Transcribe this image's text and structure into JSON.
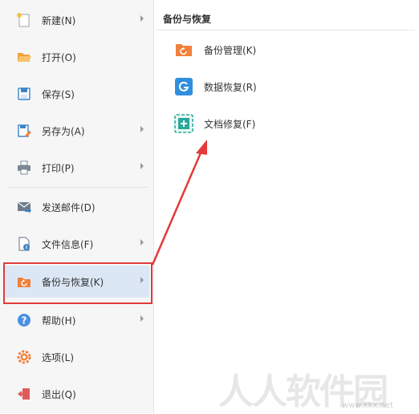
{
  "menu": {
    "items": [
      {
        "label": "新建(N)",
        "icon": "new-file-icon",
        "submenu": true
      },
      {
        "label": "打开(O)",
        "icon": "open-folder-icon",
        "submenu": false
      },
      {
        "label": "保存(S)",
        "icon": "save-icon",
        "submenu": false
      },
      {
        "label": "另存为(A)",
        "icon": "save-as-icon",
        "submenu": true
      },
      {
        "label": "打印(P)",
        "icon": "print-icon",
        "submenu": true
      },
      {
        "label": "发送邮件(D)",
        "icon": "send-mail-icon",
        "submenu": false
      },
      {
        "label": "文件信息(F)",
        "icon": "file-info-icon",
        "submenu": true
      },
      {
        "label": "备份与恢复(K)",
        "icon": "backup-restore-icon",
        "submenu": true,
        "active": true
      },
      {
        "label": "帮助(H)",
        "icon": "help-icon",
        "submenu": true
      },
      {
        "label": "选项(L)",
        "icon": "options-gear-icon",
        "submenu": false
      },
      {
        "label": "退出(Q)",
        "icon": "exit-icon",
        "submenu": false
      }
    ]
  },
  "submenu": {
    "title": "备份与恢复",
    "items": [
      {
        "label": "备份管理(K)",
        "icon": "backup-manage-icon"
      },
      {
        "label": "数据恢复(R)",
        "icon": "data-recovery-icon"
      },
      {
        "label": "文档修复(F)",
        "icon": "doc-repair-icon"
      }
    ]
  },
  "watermark": {
    "text": "人人软件园",
    "url": "www.kkx.net"
  },
  "colors": {
    "highlight_border": "#e23a3a",
    "active_bg": "#dbe7f5",
    "accent_orange": "#f0803c",
    "accent_blue": "#2f8fdc",
    "accent_teal": "#2aa89a"
  }
}
